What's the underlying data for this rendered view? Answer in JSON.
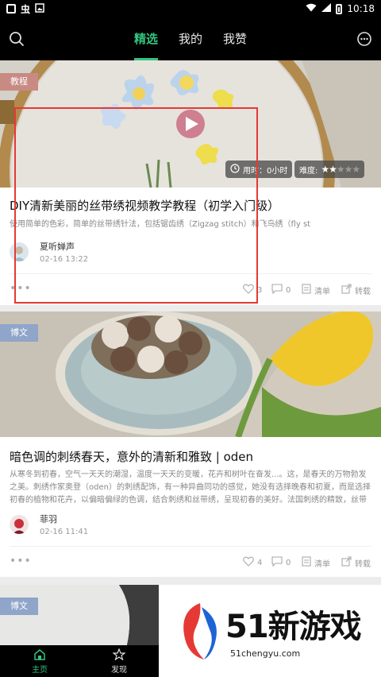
{
  "status_bar": {
    "glyph_left": "虫",
    "time": "10:18"
  },
  "header": {
    "tabs": [
      {
        "label": "精选",
        "active": true
      },
      {
        "label": "我的",
        "active": false
      },
      {
        "label": "我赞",
        "active": false
      }
    ],
    "search_icon": "search-icon",
    "menu_icon": "more-icon"
  },
  "cards": [
    {
      "tag": "教程",
      "tag_color": "#c98a84",
      "duration_label": "用时：0小时",
      "difficulty_label": "难度:",
      "difficulty_stars": 2,
      "difficulty_max": 5,
      "title": "DIY清新美丽的丝带绣视频教学教程（初学入门级）",
      "desc": "使用简单的色彩，简单的丝带绣针法，包括锯齿绣（Zigzag stitch）和飞鸟绣（fly st",
      "author": "夏听婵声",
      "time": "02-16 13:22",
      "likes": "3",
      "comments": "0",
      "list_label": "清单",
      "share_label": "转载"
    },
    {
      "tag": "博文",
      "tag_color": "#8fa5c9",
      "title": "暗色调的刺绣春天，意外的清新和雅致 | oden",
      "desc": "从寒冬到初春，空气一天天的潮湿，温度一天天的变暖，花卉和树叶在奋发...。这，是春天的万物勃发之美。刺绣作家奥登（oden）的刺绣配饰，有一种异曲同功的感觉，她没有选择晚春和初夏，而是选择初春的植物和花卉，以偏暗偏绿的色调，结合刺绣和丝带绣，呈现初春的美好。法国刺绣的精致，丝带绣的立体...",
      "author": "菲羽",
      "time": "02-16 11:41",
      "likes": "4",
      "comments": "0",
      "list_label": "清单",
      "share_label": "转载"
    },
    {
      "tag": "博文",
      "tag_color": "#8fa5c9"
    }
  ],
  "bottom_nav": [
    {
      "label": "主页",
      "icon": "home-icon",
      "active": true
    },
    {
      "label": "发现",
      "icon": "discover-icon",
      "active": false
    }
  ],
  "watermark": {
    "logo_text": "51新游戏",
    "url": "51chengyu.com"
  },
  "colors": {
    "accent": "#33c47f",
    "highlight_box": "#e53935"
  }
}
